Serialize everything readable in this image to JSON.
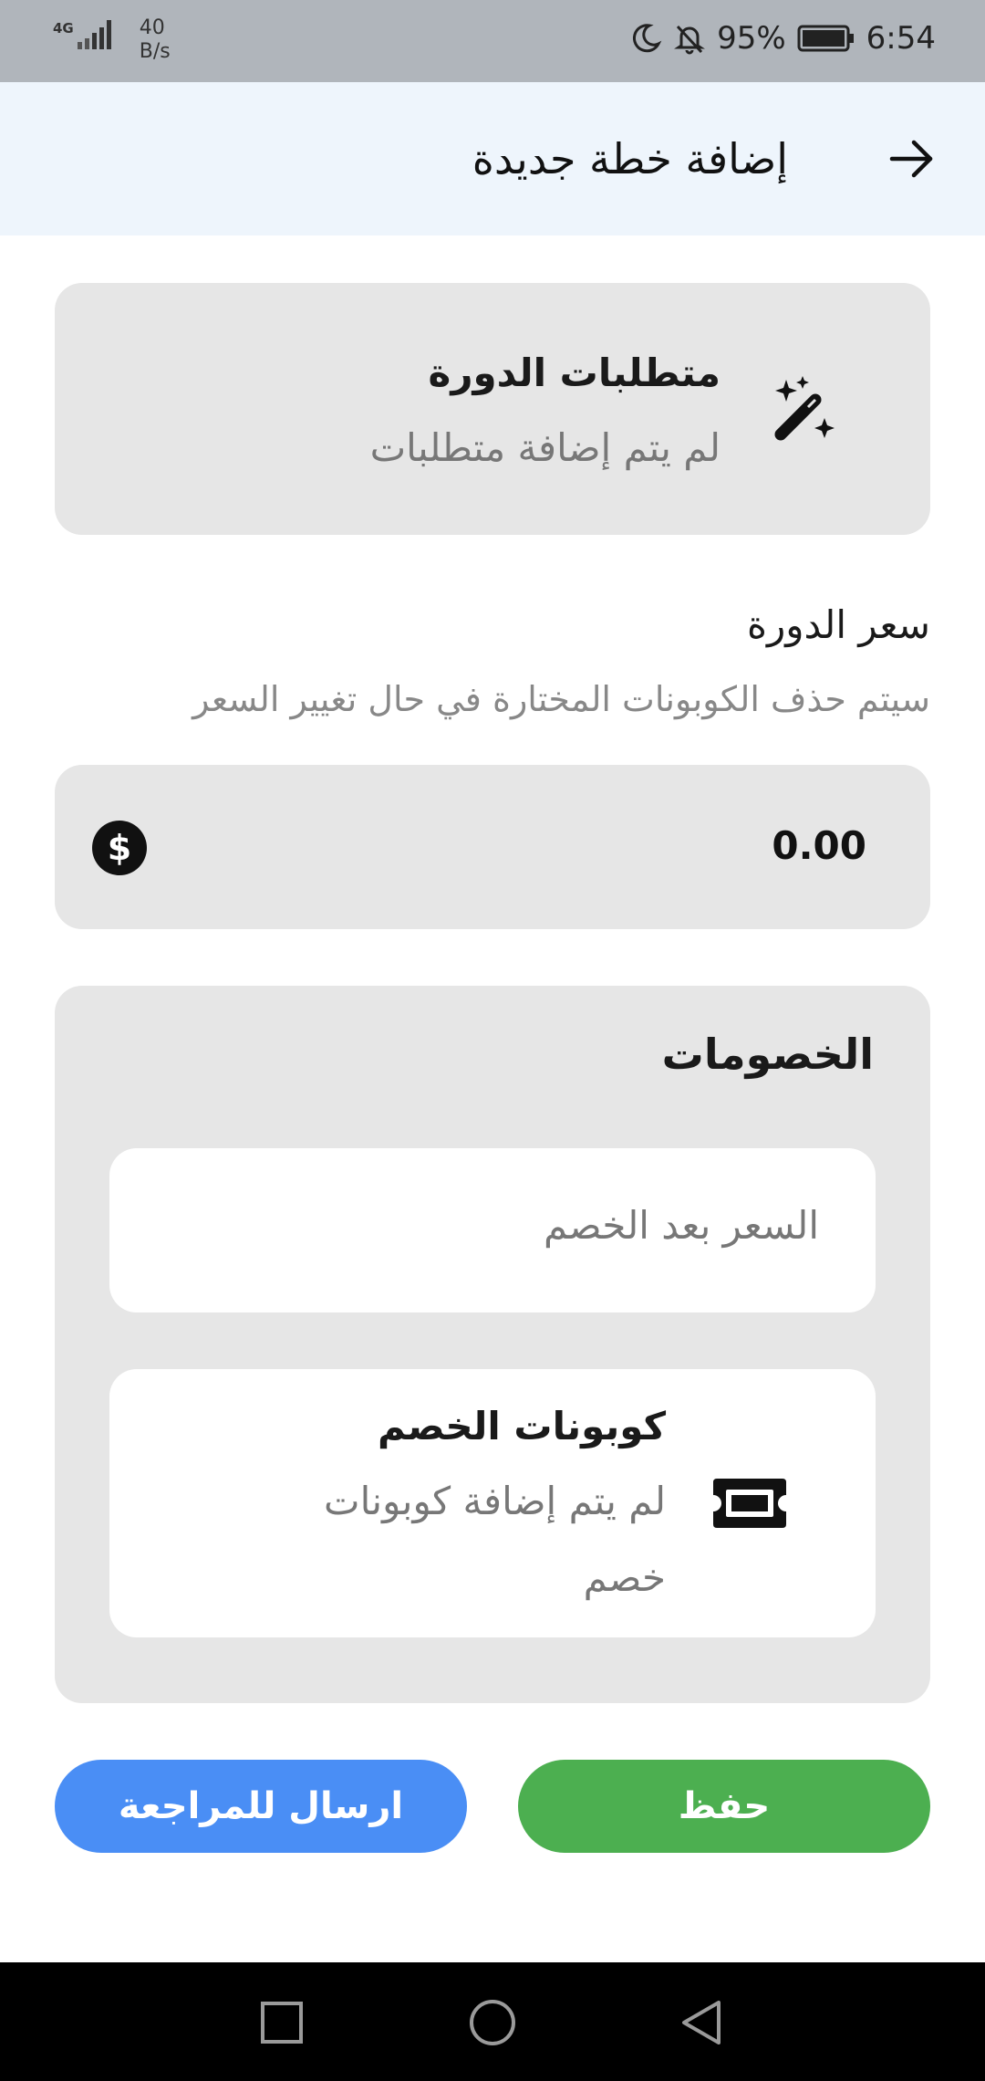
{
  "status_bar": {
    "network": "4G",
    "speed_value": "40",
    "speed_unit": "B/s",
    "battery": "95%",
    "time": "6:54",
    "icons": [
      "signal-icon",
      "moon-icon",
      "bell-off-icon",
      "battery-icon"
    ]
  },
  "header": {
    "title": "إضافة خطة جديدة",
    "back_icon": "arrow-right-icon"
  },
  "requirements": {
    "title": "متطلبات الدورة",
    "subtitle": "لم يتم إضافة متطلبات",
    "icon": "magic-wand-icon"
  },
  "price": {
    "label": "سعر الدورة",
    "note": "سيتم حذف الكوبونات المختارة في حال تغيير السعر",
    "value": "0.00",
    "icon": "dollar-icon"
  },
  "discounts": {
    "title": "الخصومات",
    "discounted_price_placeholder": "السعر بعد الخصم",
    "coupons_title": "كوبونات الخصم",
    "coupons_line1": "لم يتم إضافة كوبونات",
    "coupons_line2": "خصم",
    "coupons_icon": "ticket-icon"
  },
  "actions": {
    "save_label": "حفظ",
    "submit_label": "ارسال للمراجعة"
  },
  "colors": {
    "save": "#4caf50",
    "submit": "#4a8ef5",
    "header_bg": "#eef5fc",
    "card_bg": "#e6e6e6"
  },
  "nav": {
    "recent_icon": "square-icon",
    "home_icon": "circle-icon",
    "back_icon": "triangle-back-icon"
  }
}
